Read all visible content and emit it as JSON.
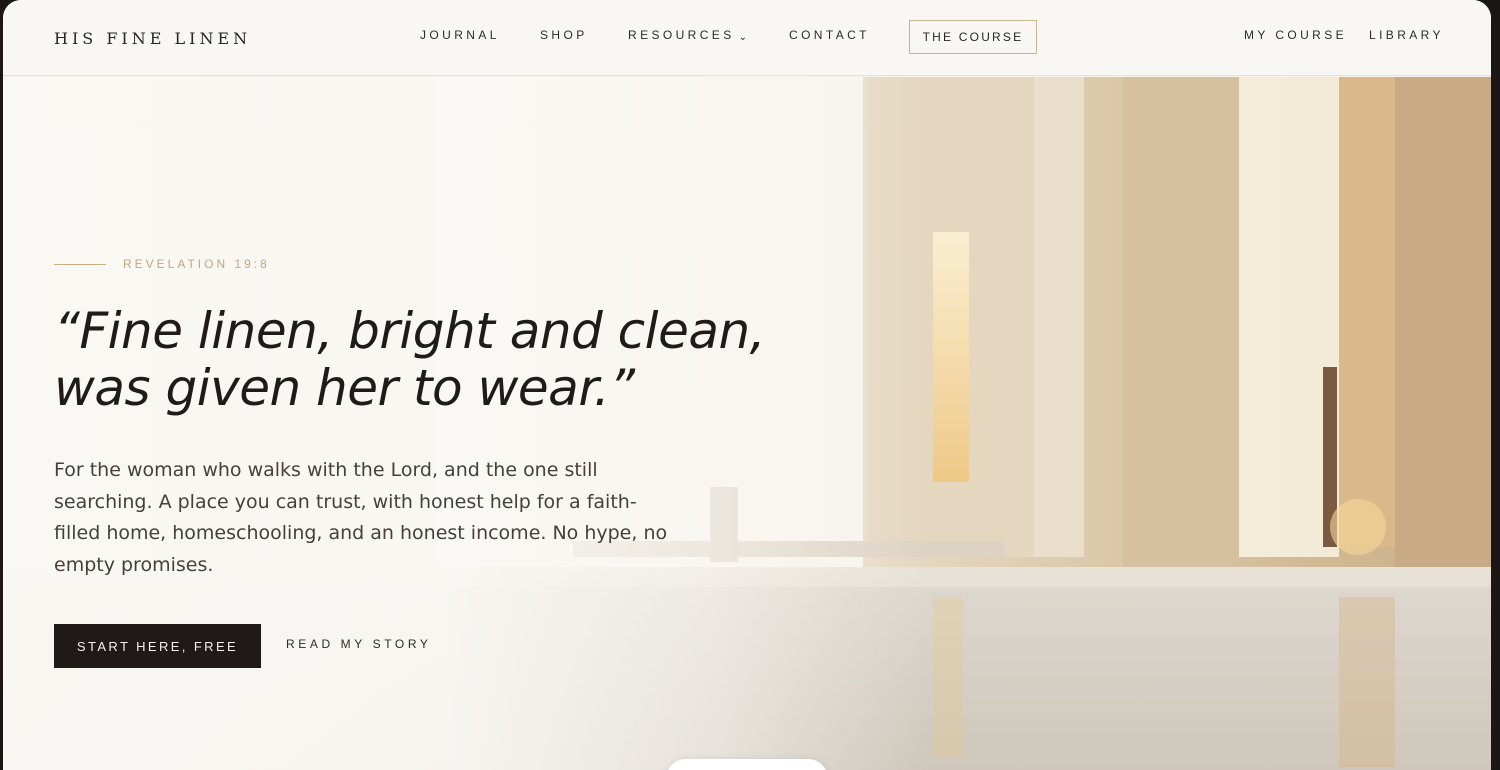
{
  "header": {
    "logo": "HIS FINE LINEN",
    "nav": {
      "journal": "JOURNAL",
      "shop": "SHOP",
      "resources": "RESOURCES",
      "contact": "CONTACT",
      "course": "THE COURSE",
      "my_course": "MY COURSE",
      "library": "LIBRARY"
    },
    "resources_icon": "chevron-down-icon"
  },
  "hero": {
    "eyebrow": "REVELATION 19:8",
    "quote_line1": "“Fine linen, bright and clean,",
    "quote_line2": "was given her to wear.”",
    "intro": "For the woman who walks with the Lord, and the one still searching. A place you can trust, with honest help for a faith-filled home, homeschooling, and an honest income. No hype, no empty promises.",
    "cta_primary": "START HERE, FREE",
    "cta_secondary": "READ MY STORY"
  },
  "colors": {
    "accent_gold": "#c4a679",
    "dark_button": "#1f1a17",
    "header_bg": "#f8f7f3",
    "text_dark": "#1f1b18"
  }
}
